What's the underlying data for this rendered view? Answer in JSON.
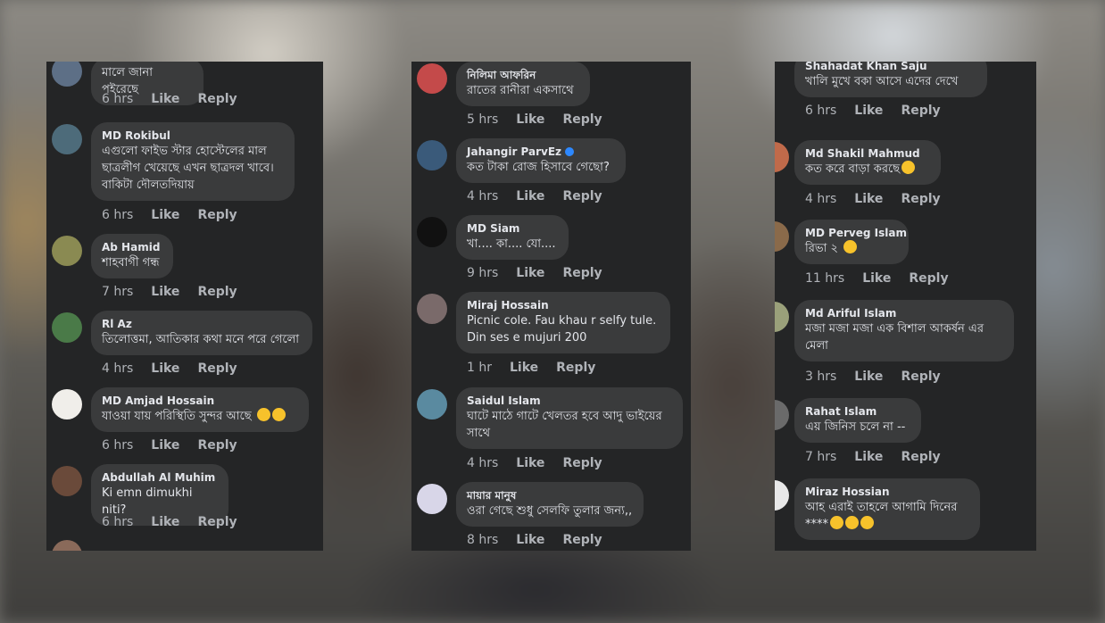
{
  "panels": [
    {
      "comments": [
        {
          "author": "",
          "text": "মালে জানা পইরেছে",
          "time": "6 hrs"
        },
        {
          "author": "MD Rokibul",
          "text": "এগুলো ফাইভ স্টার হোস্টেলের মাল ছাত্রলীগ খেয়েছে এখন ছাত্রদল খাবে। বাকিটা দৌলতদিয়ায়",
          "time": "6 hrs"
        },
        {
          "author": "Ab Hamid",
          "text": "শাহবাগী গন্ধ",
          "time": "7 hrs"
        },
        {
          "author": "Rl Az",
          "text": "তিলোত্তমা, আতিকার কথা মনে পরে গেলো",
          "time": "4 hrs"
        },
        {
          "author": "MD Amjad Hossain",
          "text": "যাওয়া যায় পরিস্থিতি সুন্দর আছে",
          "time": "6 hrs"
        },
        {
          "author": "Abdullah Al Muhim",
          "text": "Ki emn dimukhi niti?",
          "time": "6 hrs"
        }
      ]
    },
    {
      "comments": [
        {
          "author": "নিলিমা আফরিন",
          "text": "রাতের রানীরা একসাথে",
          "time": "5 hrs"
        },
        {
          "author": "Jahangir ParvEz",
          "text": "কত টাকা রোজ হিসাবে গেছো?",
          "time": "4 hrs"
        },
        {
          "author": "MD Siam",
          "text": "খা.... কা.... যো....",
          "time": "9 hrs"
        },
        {
          "author": "Miraj Hossain",
          "text": "Picnic cole. Fau khau r selfy tule. Din ses e mujuri 200",
          "time": "1 hr"
        },
        {
          "author": "Saidul Islam",
          "text": "ঘাটে মাঠে গাটে খেলতর হবে আদু ভাইয়ের সাথে",
          "time": "4 hrs"
        },
        {
          "author": "মায়ার মানুষ",
          "text": "ওরা গেছে শুধু সেলফি তুলার জন্য,,",
          "time": "8 hrs"
        }
      ]
    },
    {
      "comments": [
        {
          "author": "Shahadat Khan Saju",
          "text": "খালি মুখে বকা আসে এদের দেখে",
          "time": "6 hrs"
        },
        {
          "author": "Md Shakil Mahmud",
          "text": "কত করে বাড়া করছে",
          "time": "4 hrs"
        },
        {
          "author": "MD Perveg Islam",
          "text": "রিভা ২",
          "time": "11 hrs"
        },
        {
          "author": "Md Ariful Islam",
          "text": "মজা মজা মজা এক বিশাল আকর্ষন এর মেলা",
          "time": "3 hrs"
        },
        {
          "author": "Rahat Islam",
          "text": "এয় জিনিস চলে না --",
          "time": "7 hrs"
        },
        {
          "author": "Miraz Hossian",
          "text": "আহ এরাই তাহলে আগামি দিনের ****",
          "time": ""
        }
      ]
    }
  ],
  "actions": {
    "like": "Like",
    "reply": "Reply"
  },
  "colors": {
    "panel_bg": "#242526",
    "bubble_bg": "#3a3b3c",
    "text": "#e4e6eb",
    "meta": "#b0b3b8",
    "verified": "#2d88ff"
  }
}
